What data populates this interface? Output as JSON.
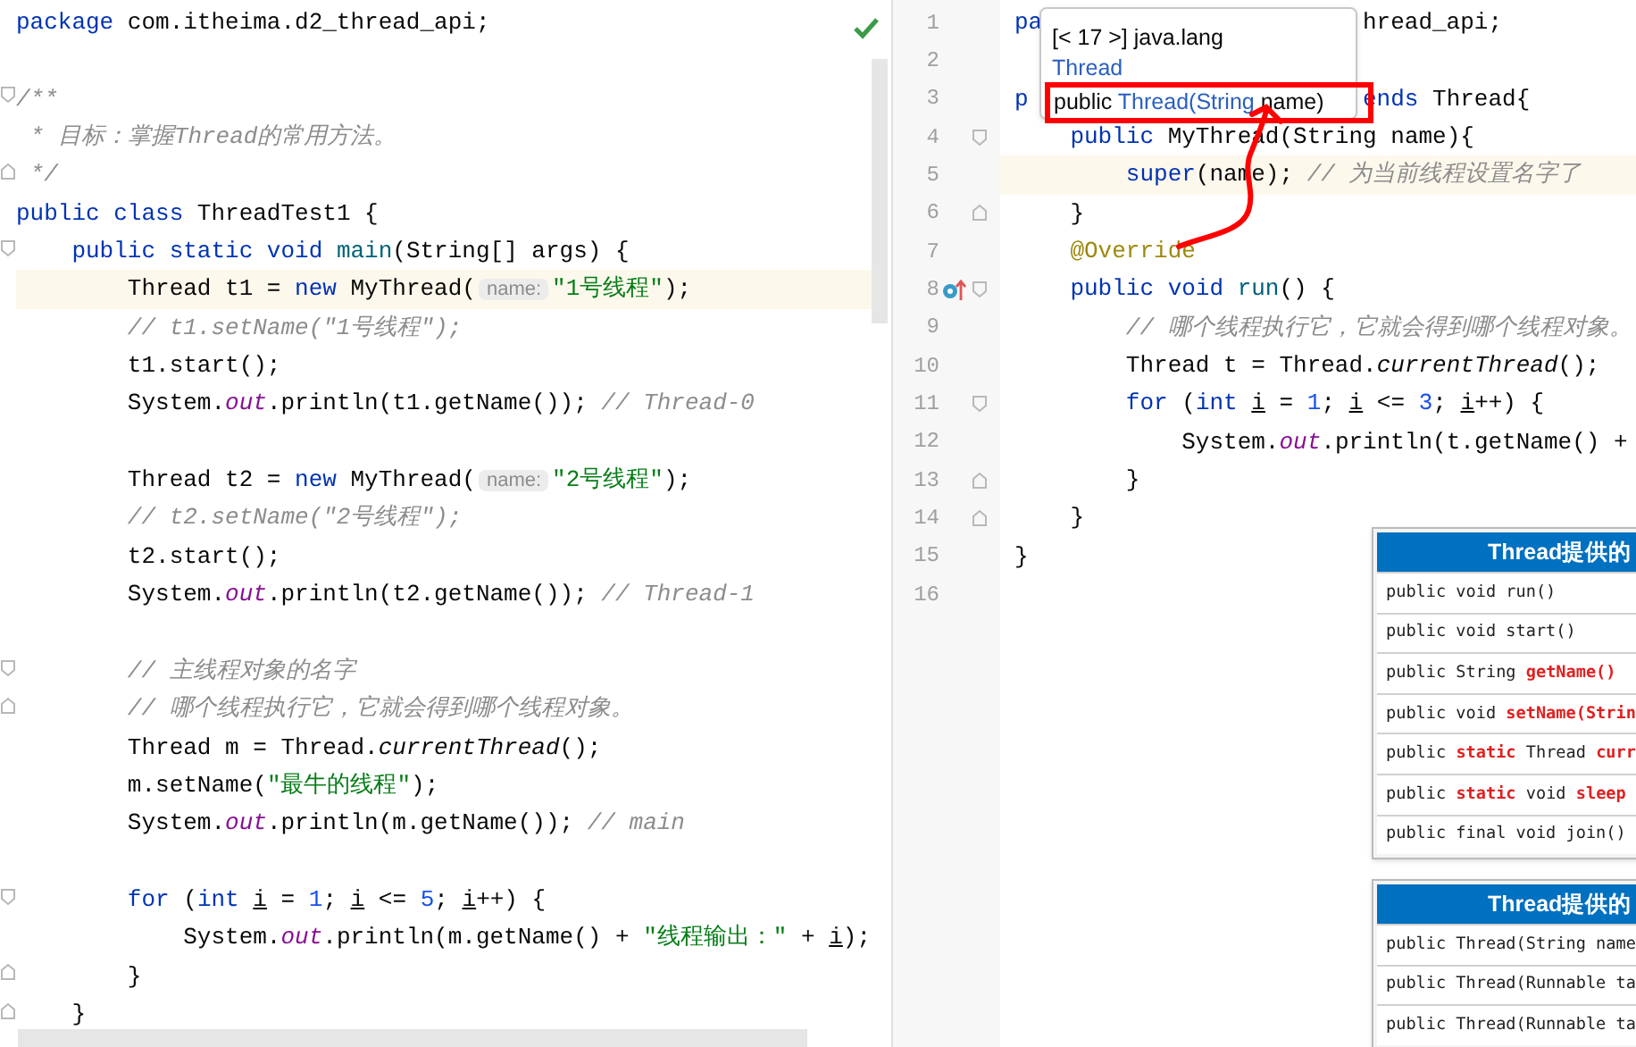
{
  "left_editor": {
    "lines": [
      {
        "kind": "plain",
        "highlighted": false,
        "tokens": [
          {
            "t": "package",
            "kind": "kw"
          },
          {
            "t": " com.itheima.d2_thread_api;",
            "kind": "plain"
          }
        ]
      },
      {
        "kind": "plain",
        "highlighted": false
      },
      {
        "kind": "fold_start",
        "highlighted": false,
        "tokens": [
          {
            "t": "/**",
            "kind": "cmt"
          }
        ]
      },
      {
        "kind": "plain",
        "highlighted": false,
        "tokens": [
          {
            "t": " * 目标：掌握Thread的常用方法。",
            "kind": "cmt"
          }
        ]
      },
      {
        "kind": "fold_end",
        "highlighted": false,
        "tokens": [
          {
            "t": " */",
            "kind": "cmt"
          }
        ]
      },
      {
        "kind": "plain",
        "highlighted": false,
        "tokens": [
          {
            "t": "public class",
            "kind": "kw"
          },
          {
            "t": " ThreadTest1 {",
            "kind": "plain"
          }
        ]
      },
      {
        "kind": "fold_start",
        "highlighted": false,
        "tokens": [
          {
            "t": "    public static void",
            "kind": "kw"
          },
          {
            "t": " main",
            "kind": "fn"
          },
          {
            "t": "(String[] args) {",
            "kind": "plain"
          }
        ]
      },
      {
        "kind": "plain",
        "highlighted": true,
        "tokens": [
          {
            "t": "        Thread t1 = ",
            "kind": "plain"
          },
          {
            "t": "new",
            "kind": "kw"
          },
          {
            "t": " MyThread(",
            "kind": "plain"
          },
          {
            "t": "name:",
            "kind": "hint"
          },
          {
            "t": "\"1号线程\"",
            "kind": "str"
          },
          {
            "t": ");",
            "kind": "plain"
          }
        ]
      },
      {
        "kind": "plain",
        "highlighted": false,
        "tokens": [
          {
            "t": "        // t1.setName(\"1号线程\");",
            "kind": "cmt"
          }
        ]
      },
      {
        "kind": "plain",
        "highlighted": false,
        "tokens": [
          {
            "t": "        t1.start();",
            "kind": "plain"
          }
        ]
      },
      {
        "kind": "plain",
        "highlighted": false,
        "tokens": [
          {
            "t": "        System.",
            "kind": "plain"
          },
          {
            "t": "out",
            "kind": "field"
          },
          {
            "t": ".println(t1.getName()); ",
            "kind": "plain"
          },
          {
            "t": "// Thread-0",
            "kind": "cmt"
          }
        ]
      },
      {
        "kind": "plain",
        "highlighted": false
      },
      {
        "kind": "plain",
        "highlighted": false,
        "tokens": [
          {
            "t": "        Thread t2 = ",
            "kind": "plain"
          },
          {
            "t": "new",
            "kind": "kw"
          },
          {
            "t": " MyThread(",
            "kind": "plain"
          },
          {
            "t": "name:",
            "kind": "hint"
          },
          {
            "t": "\"2号线程\"",
            "kind": "str"
          },
          {
            "t": ");",
            "kind": "plain"
          }
        ]
      },
      {
        "kind": "plain",
        "highlighted": false,
        "tokens": [
          {
            "t": "        // t2.setName(\"2号线程\");",
            "kind": "cmt"
          }
        ]
      },
      {
        "kind": "plain",
        "highlighted": false,
        "tokens": [
          {
            "t": "        t2.start();",
            "kind": "plain"
          }
        ]
      },
      {
        "kind": "plain",
        "highlighted": false,
        "tokens": [
          {
            "t": "        System.",
            "kind": "plain"
          },
          {
            "t": "out",
            "kind": "field"
          },
          {
            "t": ".println(t2.getName()); ",
            "kind": "plain"
          },
          {
            "t": "// Thread-1",
            "kind": "cmt"
          }
        ]
      },
      {
        "kind": "plain",
        "highlighted": false
      },
      {
        "kind": "fold_start",
        "highlighted": false,
        "tokens": [
          {
            "t": "        // 主线程对象的名字",
            "kind": "cmt"
          }
        ]
      },
      {
        "kind": "fold_end",
        "highlighted": false,
        "tokens": [
          {
            "t": "        // 哪个线程执行它，它就会得到哪个线程对象。",
            "kind": "cmt"
          }
        ]
      },
      {
        "kind": "plain",
        "highlighted": false,
        "tokens": [
          {
            "t": "        Thread m = Thread.",
            "kind": "plain"
          },
          {
            "t": "currentThread",
            "kind": "italic"
          },
          {
            "t": "();",
            "kind": "plain"
          }
        ]
      },
      {
        "kind": "plain",
        "highlighted": false,
        "tokens": [
          {
            "t": "        m.setName(",
            "kind": "plain"
          },
          {
            "t": "\"最牛的线程\"",
            "kind": "str"
          },
          {
            "t": ");",
            "kind": "plain"
          }
        ]
      },
      {
        "kind": "plain",
        "highlighted": false,
        "tokens": [
          {
            "t": "        System.",
            "kind": "plain"
          },
          {
            "t": "out",
            "kind": "field"
          },
          {
            "t": ".println(m.getName()); ",
            "kind": "plain"
          },
          {
            "t": "// main",
            "kind": "cmt"
          }
        ]
      },
      {
        "kind": "plain",
        "highlighted": false
      },
      {
        "kind": "fold_start",
        "highlighted": false,
        "tokens": [
          {
            "t": "        for",
            "kind": "kw"
          },
          {
            "t": " (",
            "kind": "plain"
          },
          {
            "t": "int ",
            "kind": "kw"
          },
          {
            "t": "i",
            "kind": "var"
          },
          {
            "t": " = ",
            "kind": "plain"
          },
          {
            "t": "1",
            "kind": "num"
          },
          {
            "t": "; ",
            "kind": "plain"
          },
          {
            "t": "i",
            "kind": "var"
          },
          {
            "t": " <= ",
            "kind": "plain"
          },
          {
            "t": "5",
            "kind": "num"
          },
          {
            "t": "; ",
            "kind": "plain"
          },
          {
            "t": "i",
            "kind": "var"
          },
          {
            "t": "++) {",
            "kind": "plain"
          }
        ]
      },
      {
        "kind": "plain",
        "highlighted": false,
        "tokens": [
          {
            "t": "            System.",
            "kind": "plain"
          },
          {
            "t": "out",
            "kind": "field"
          },
          {
            "t": ".println(m.getName() + ",
            "kind": "plain"
          },
          {
            "t": "\"线程输出：\"",
            "kind": "str"
          },
          {
            "t": " + ",
            "kind": "plain"
          },
          {
            "t": "i",
            "kind": "var"
          },
          {
            "t": ");",
            "kind": "plain"
          }
        ]
      },
      {
        "kind": "fold_end",
        "highlighted": false,
        "tokens": [
          {
            "t": "        }",
            "kind": "plain"
          }
        ]
      },
      {
        "kind": "fold_end",
        "highlighted": false,
        "tokens": [
          {
            "t": "    }",
            "kind": "plain"
          }
        ]
      }
    ]
  },
  "right_editor": {
    "lines": [
      {
        "number": "1",
        "kind": "plain",
        "highlighted": false,
        "tokens": [
          {
            "t": "pa",
            "kind": "kw"
          }
        ],
        "tail": [
          {
            "t": "hread_api;",
            "kind": "plain"
          }
        ]
      },
      {
        "number": "2",
        "kind": "plain",
        "highlighted": false
      },
      {
        "number": "3",
        "kind": "plain",
        "highlighted": false,
        "tokens": [
          {
            "t": "p",
            "kind": "kw"
          }
        ],
        "tail": [
          {
            "t": "ends",
            "kind": "kw"
          },
          {
            "t": " Thread{",
            "kind": "plain"
          }
        ]
      },
      {
        "number": "4",
        "kind": "fold_start",
        "highlighted": false,
        "tokens": [
          {
            "t": "    public",
            "kind": "kw"
          },
          {
            "t": " MyThread(String name){",
            "kind": "plain"
          }
        ]
      },
      {
        "number": "5",
        "kind": "plain",
        "highlighted": true,
        "tokens": [
          {
            "t": "        super",
            "kind": "kw"
          },
          {
            "t": "(name); ",
            "kind": "plain"
          },
          {
            "t": "// 为当前线程设置名字了",
            "kind": "cmt"
          }
        ]
      },
      {
        "number": "6",
        "kind": "fold_end",
        "highlighted": false,
        "tokens": [
          {
            "t": "    }",
            "kind": "plain"
          }
        ]
      },
      {
        "number": "7",
        "kind": "plain",
        "highlighted": false,
        "tokens": [
          {
            "t": "    @Override",
            "kind": "annot"
          }
        ]
      },
      {
        "number": "8",
        "kind": "override",
        "highlighted": false,
        "tokens": [
          {
            "t": "    public void",
            "kind": "kw"
          },
          {
            "t": " run",
            "kind": "fn"
          },
          {
            "t": "() {",
            "kind": "plain"
          }
        ]
      },
      {
        "number": "9",
        "kind": "plain",
        "highlighted": false,
        "tokens": [
          {
            "t": "        // 哪个线程执行它，它就会得到哪个线程对象。",
            "kind": "cmt"
          }
        ]
      },
      {
        "number": "10",
        "kind": "plain",
        "highlighted": false,
        "tokens": [
          {
            "t": "        Thread t = Thread.",
            "kind": "plain"
          },
          {
            "t": "currentThread",
            "kind": "italic"
          },
          {
            "t": "();",
            "kind": "plain"
          }
        ]
      },
      {
        "number": "11",
        "kind": "fold_start",
        "highlighted": false,
        "tokens": [
          {
            "t": "        for",
            "kind": "kw"
          },
          {
            "t": " (",
            "kind": "plain"
          },
          {
            "t": "int ",
            "kind": "kw"
          },
          {
            "t": "i",
            "kind": "var"
          },
          {
            "t": " = ",
            "kind": "plain"
          },
          {
            "t": "1",
            "kind": "num"
          },
          {
            "t": "; ",
            "kind": "plain"
          },
          {
            "t": "i",
            "kind": "var"
          },
          {
            "t": " <= ",
            "kind": "plain"
          },
          {
            "t": "3",
            "kind": "num"
          },
          {
            "t": "; ",
            "kind": "plain"
          },
          {
            "t": "i",
            "kind": "var"
          },
          {
            "t": "++) {",
            "kind": "plain"
          }
        ]
      },
      {
        "number": "12",
        "kind": "plain",
        "highlighted": false,
        "tokens": [
          {
            "t": "            System.",
            "kind": "plain"
          },
          {
            "t": "out",
            "kind": "field"
          },
          {
            "t": ".println(t.getName() +",
            "kind": "plain"
          }
        ]
      },
      {
        "number": "13",
        "kind": "fold_end",
        "highlighted": false,
        "tokens": [
          {
            "t": "        }",
            "kind": "plain"
          }
        ]
      },
      {
        "number": "14",
        "kind": "fold_end",
        "highlighted": false,
        "tokens": [
          {
            "t": "    }",
            "kind": "plain"
          }
        ]
      },
      {
        "number": "15",
        "kind": "plain",
        "highlighted": false,
        "tokens": [
          {
            "t": "}",
            "kind": "plain"
          }
        ]
      },
      {
        "number": "16",
        "kind": "plain",
        "highlighted": false
      }
    ]
  },
  "tooltip": {
    "header": "[< 17 >] java.lang",
    "link": "Thread",
    "signature": [
      {
        "t": "public ",
        "kind": "plain"
      },
      {
        "t": "Thread(String",
        "kind": "link"
      },
      {
        "t": " name)",
        "kind": "plain"
      }
    ]
  },
  "reference_tables": [
    {
      "title": "Thread提供的",
      "rows": [
        "public void run()",
        "public void start()",
        "public String **getName()**",
        "public void **setName(Strin**",
        "public **static** Thread **curr**",
        "public **static** void **sleep**",
        "public final void join()"
      ]
    },
    {
      "title": "Thread提供的",
      "rows": [
        "public Thread(String name",
        "public Thread(Runnable ta",
        "public Thread(Runnable ta"
      ]
    }
  ]
}
